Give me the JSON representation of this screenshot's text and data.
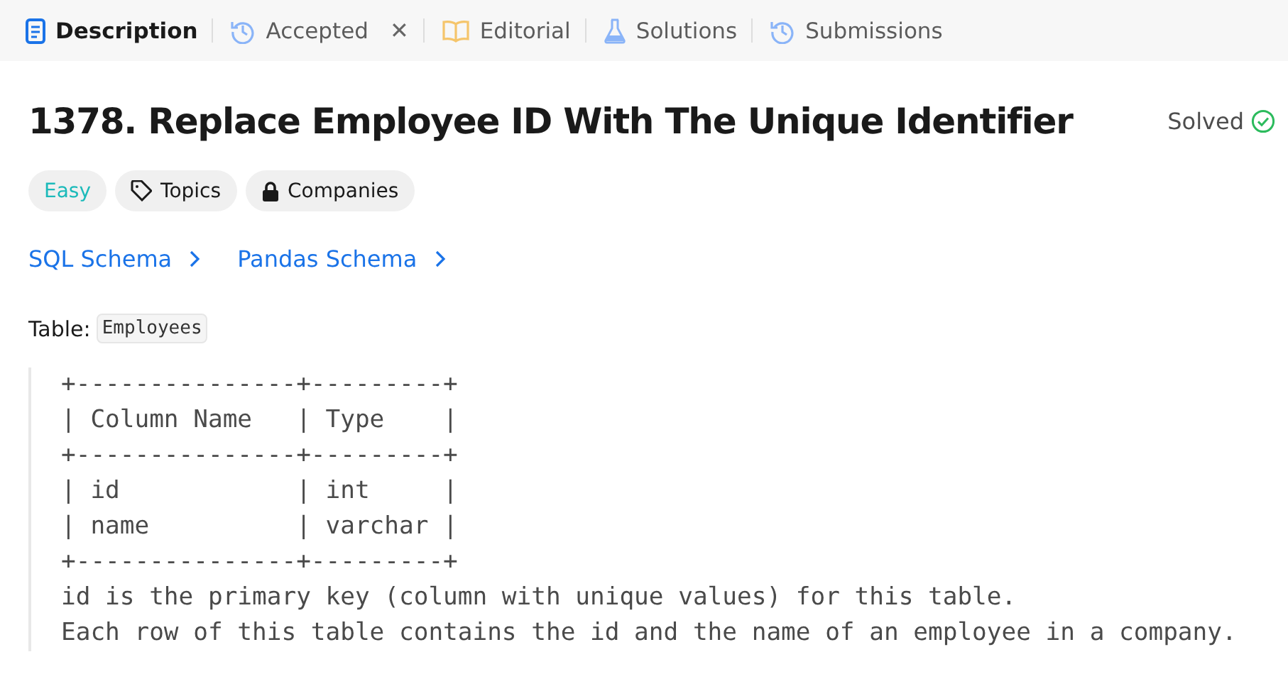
{
  "tabs": [
    {
      "label": "Description",
      "kind": "document",
      "selected": true
    },
    {
      "label": "Accepted",
      "kind": "history",
      "selected": false,
      "close": "✕"
    },
    {
      "label": "Editorial",
      "kind": "book",
      "selected": false
    },
    {
      "label": "Solutions",
      "kind": "flask",
      "selected": false
    },
    {
      "label": "Submissions",
      "kind": "history",
      "selected": false
    }
  ],
  "problem": {
    "title": "1378. Replace Employee ID With The Unique Identifier",
    "status": "Solved",
    "tags": [
      {
        "kind": "difficulty",
        "label": "Easy"
      },
      {
        "kind": "tag",
        "label": "Topics"
      },
      {
        "kind": "lock",
        "label": "Companies"
      }
    ],
    "links": [
      "SQL Schema",
      "Pandas Schema"
    ],
    "table_label": "Table:",
    "table_name": "Employees",
    "code_lines": [
      "+---------------+---------+",
      "| Column Name   | Type    |",
      "+---------------+---------+",
      "| id            | int     |",
      "| name          | varchar |",
      "+---------------+---------+",
      "id is the primary key (column with unique values) for this table.",
      "Each row of this table contains the id and the name of an employee in a company."
    ]
  }
}
